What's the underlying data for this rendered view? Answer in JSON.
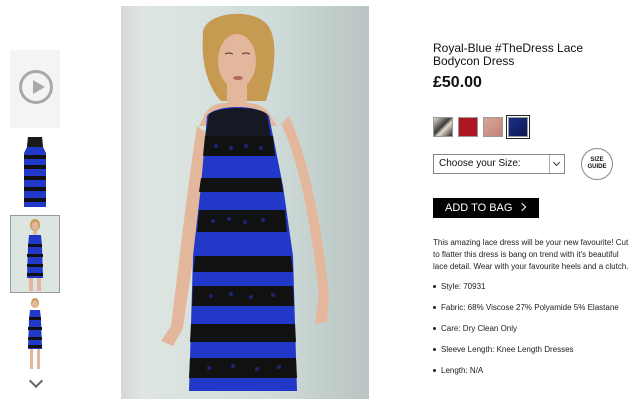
{
  "product": {
    "title": "Royal-Blue #TheDress Lace Bodycon Dress",
    "price": "£50.00",
    "size_select": {
      "value": "Choose your Size:"
    },
    "size_guide_line1": "SIZE",
    "size_guide_line2": "GUIDE",
    "add_to_bag_label": "ADD TO BAG",
    "description": "This amazing lace dress will be your new favourite! Cut to flatter this dress is bang on trend with it's beautiful lace detail. Wear with your favourite heels and a clutch.",
    "specs": [
      "Style: 70931",
      "Fabric: 68% Viscose 27% Polyamide 5% Elastane",
      "Care: Dry Clean Only",
      "Sleeve Length: Knee Length Dresses",
      "Length: N/A"
    ],
    "swatches": [
      {
        "name": "cream-black",
        "color": "#d9d0c2"
      },
      {
        "name": "red",
        "color": "#b01622"
      },
      {
        "name": "nude",
        "color": "#d8a69a"
      },
      {
        "name": "royal-blue",
        "color": "#1b2f8a",
        "selected": true
      }
    ]
  },
  "colors": {
    "dress_blue": "#2238c8",
    "lace_black": "#111111",
    "skin": "#e3b79c",
    "hair": "#c79a52"
  },
  "icons": [
    "play-icon",
    "chevron-down-icon",
    "chevron-right-icon"
  ]
}
